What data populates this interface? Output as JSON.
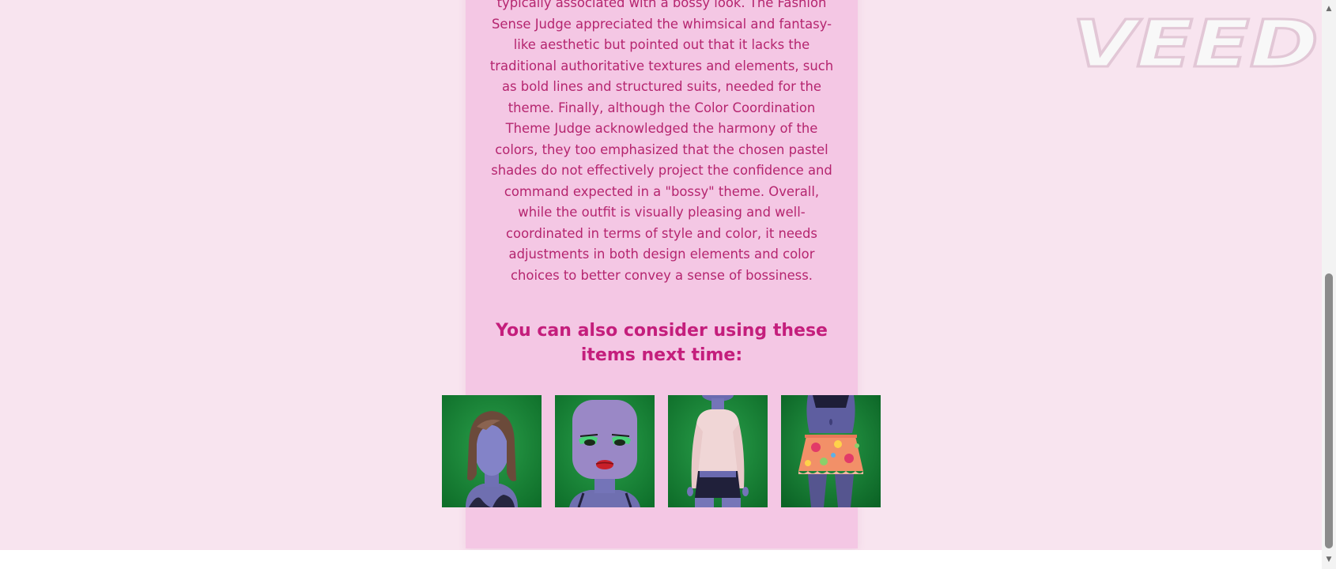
{
  "feedback": {
    "text": "typically associated with a bossy look. The Fashion Sense Judge appreciated the whimsical and fantasy-like aesthetic but pointed out that it lacks the traditional authoritative textures and elements, such as bold lines and structured suits, needed for the theme. Finally, although the Color Coordination Theme Judge acknowledged the harmony of the colors, they too emphasized that the chosen pastel shades do not effectively project the confidence and command expected in a \"bossy\" theme. Overall, while the outfit is visually pleasing and well-coordinated in terms of style and color, it needs adjustments in both design elements and color choices to better convey a sense of bossiness."
  },
  "suggestions": {
    "heading": "You can also consider using these items next time:",
    "items": [
      {
        "icon": "hair-item-icon"
      },
      {
        "icon": "makeup-item-icon"
      },
      {
        "icon": "top-item-icon"
      },
      {
        "icon": "skirt-item-icon"
      }
    ]
  },
  "watermark": {
    "text": "VEED"
  },
  "scrollbar": {
    "up_arrow": "▲",
    "down_arrow": "▼"
  },
  "colors": {
    "page_background": "#f8e4ef",
    "card_background": "#f4c7e4",
    "body_text": "#b5256f",
    "heading_text": "#c41e7c",
    "item_background": "#1d8a3c"
  }
}
